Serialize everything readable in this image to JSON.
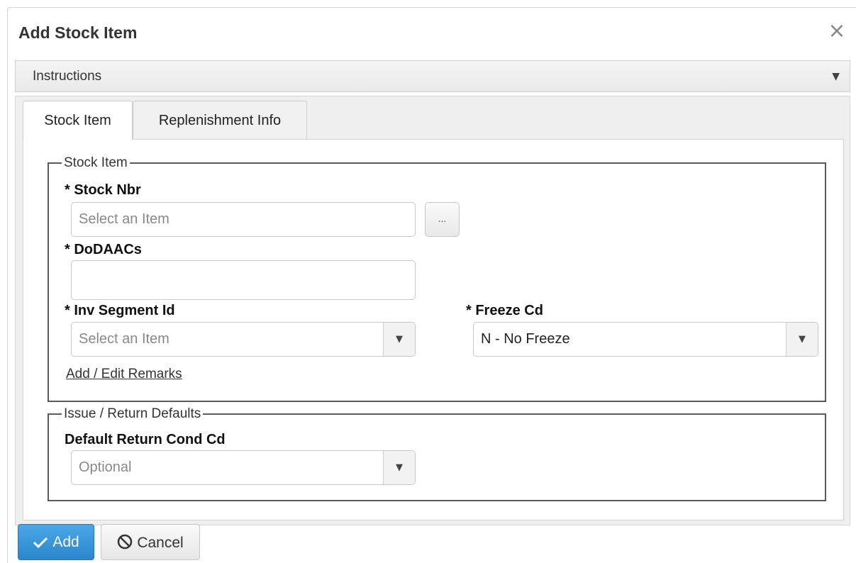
{
  "dialog": {
    "title": "Add Stock Item",
    "close_icon": "close-icon",
    "close_glyph": "×"
  },
  "instructions": {
    "label": "Instructions",
    "caret": "▼"
  },
  "tabs": [
    {
      "label": "Stock Item",
      "active": true
    },
    {
      "label": "Replenishment Info",
      "active": false
    }
  ],
  "stock_item_group": {
    "legend": "Stock Item",
    "stock_nbr": {
      "label": "* Stock Nbr",
      "placeholder": "Select an Item",
      "lookup_label": "..."
    },
    "dodaacs": {
      "label": "* DoDAACs",
      "value": ""
    },
    "inv_segment": {
      "label": "* Inv Segment Id",
      "placeholder": "Select an Item"
    },
    "freeze_cd": {
      "label": "* Freeze Cd",
      "value": "N - No Freeze"
    },
    "remarks_link": "Add / Edit Remarks"
  },
  "issue_return_group": {
    "legend": "Issue / Return Defaults",
    "default_return_cond": {
      "label": "Default Return Cond Cd",
      "placeholder": "Optional"
    }
  },
  "dropdown_caret": "▼",
  "footer": {
    "add_label": "Add",
    "cancel_label": "Cancel"
  },
  "colors": {
    "primary_button": "#2a86cc",
    "fieldset_border": "#5a5a5a"
  }
}
